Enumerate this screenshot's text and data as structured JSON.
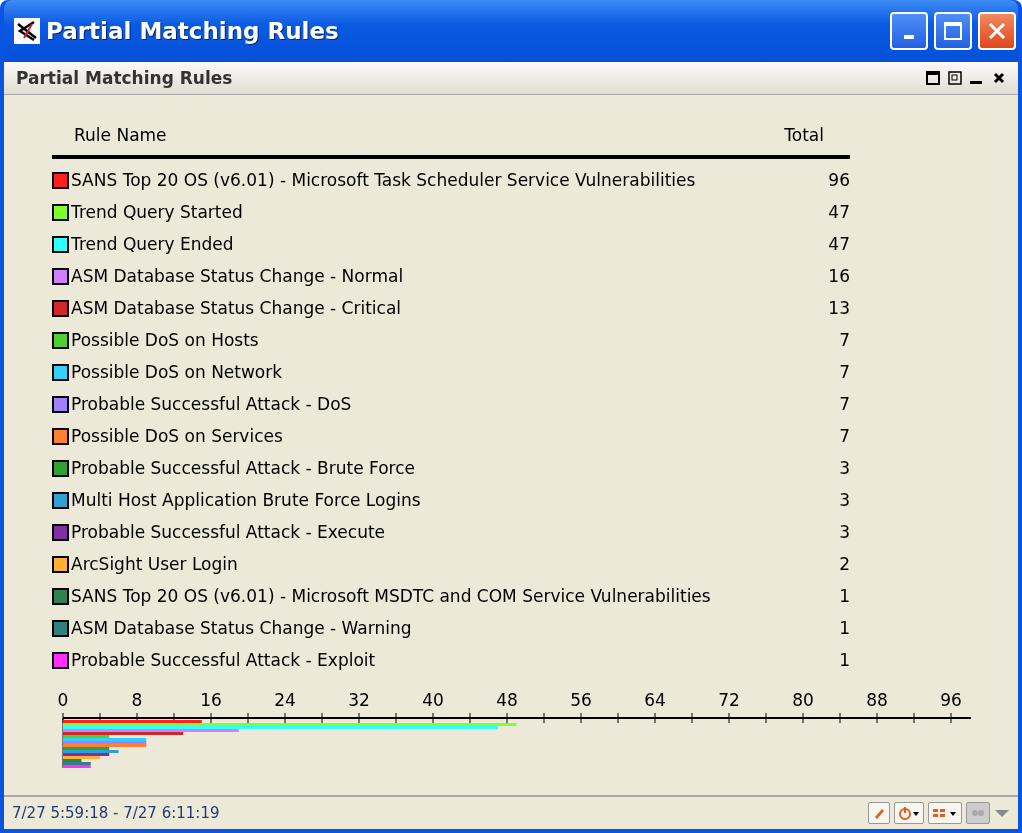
{
  "window": {
    "title": "Partial Matching Rules"
  },
  "panel": {
    "title": "Partial Matching Rules"
  },
  "table": {
    "columns": [
      "Rule Name",
      "Total"
    ],
    "rows": [
      {
        "name": "SANS Top 20 OS (v6.01) - Microsoft Task Scheduler Service Vulnerabilities",
        "total": "96",
        "color": "#ff2020"
      },
      {
        "name": "Trend Query Started",
        "total": "47",
        "color": "#80ff30"
      },
      {
        "name": "Trend Query Ended",
        "total": "47",
        "color": "#30ffff"
      },
      {
        "name": "ASM Database Status Change - Normal",
        "total": "16",
        "color": "#d080ff"
      },
      {
        "name": "ASM Database Status Change - Critical",
        "total": "13",
        "color": "#d02828"
      },
      {
        "name": "Possible DoS on Hosts",
        "total": "7",
        "color": "#50d030"
      },
      {
        "name": "Possible DoS on Network",
        "total": "7",
        "color": "#30d0ff"
      },
      {
        "name": "Probable Successful Attack - DoS",
        "total": "7",
        "color": "#a080ff"
      },
      {
        "name": "Possible DoS on Services",
        "total": "7",
        "color": "#ff8030"
      },
      {
        "name": "Probable Successful Attack - Brute Force",
        "total": "3",
        "color": "#30a030"
      },
      {
        "name": "Multi Host Application Brute Force Logins",
        "total": "3",
        "color": "#30a0d0"
      },
      {
        "name": "Probable Successful Attack - Execute",
        "total": "3",
        "color": "#8030a0"
      },
      {
        "name": "ArcSight User Login",
        "total": "2",
        "color": "#ffb030"
      },
      {
        "name": "SANS Top 20 OS (v6.01) - Microsoft MSDTC and COM Service Vulnerabilities",
        "total": "1",
        "color": "#308050"
      },
      {
        "name": "ASM Database Status Change - Warning",
        "total": "1",
        "color": "#308080"
      },
      {
        "name": "Probable Successful Attack - Exploit",
        "total": "1",
        "color": "#ff30ff"
      }
    ]
  },
  "bar_strip": {
    "tick_labels": [
      "0",
      "8",
      "16",
      "24",
      "32",
      "40",
      "48",
      "56",
      "64",
      "72",
      "80",
      "88",
      "96"
    ]
  },
  "status_bar": {
    "time_range": "7/27 5:59:18 - 7/27 6:11:19"
  }
}
